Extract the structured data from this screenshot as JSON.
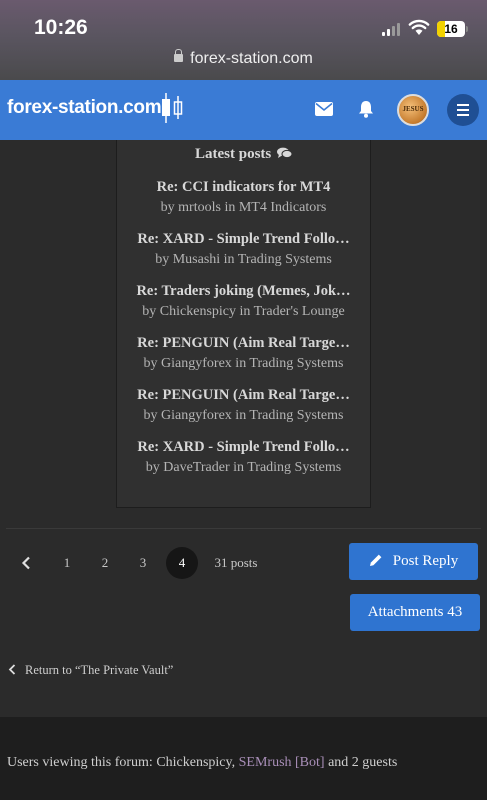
{
  "status_bar": {
    "time": "10:26",
    "battery": "16"
  },
  "browser": {
    "url": "forex-station.com"
  },
  "header": {
    "logo_text": "forex-station.com"
  },
  "latest_posts": {
    "title": "Latest posts",
    "posts": [
      {
        "title": "Re: CCI indicators for MT4",
        "meta": "by mrtools in MT4 Indicators"
      },
      {
        "title": "Re: XARD - Simple Trend Follo…",
        "meta": "by Musashi in Trading Systems"
      },
      {
        "title": "Re: Traders joking (Memes, Jok…",
        "meta": "by Chickenspicy in Trader's Lounge"
      },
      {
        "title": "Re: PENGUIN (Aim Real Targe…",
        "meta": "by Giangyforex in Trading Systems"
      },
      {
        "title": "Re: PENGUIN (Aim Real Targe…",
        "meta": "by Giangyforex in Trading Systems"
      },
      {
        "title": "Re: XARD - Simple Trend Follo…",
        "meta": "by DaveTrader in Trading Systems"
      }
    ]
  },
  "pagination": {
    "pages": [
      "1",
      "2",
      "3",
      "4"
    ],
    "current": "4",
    "total": "31 posts"
  },
  "actions": {
    "post_reply": "Post Reply",
    "attachments": "Attachments 43"
  },
  "return_link": "Return to “The Private Vault”",
  "who_online": {
    "prefix": "Users viewing this forum: Chickenspicy, ",
    "bot": "SEMrush [Bot]",
    "suffix": " and 2 guests"
  },
  "colors": {
    "header": "#3a7bd5",
    "button": "#2f74d0",
    "bot_name": "#a98fb8"
  }
}
